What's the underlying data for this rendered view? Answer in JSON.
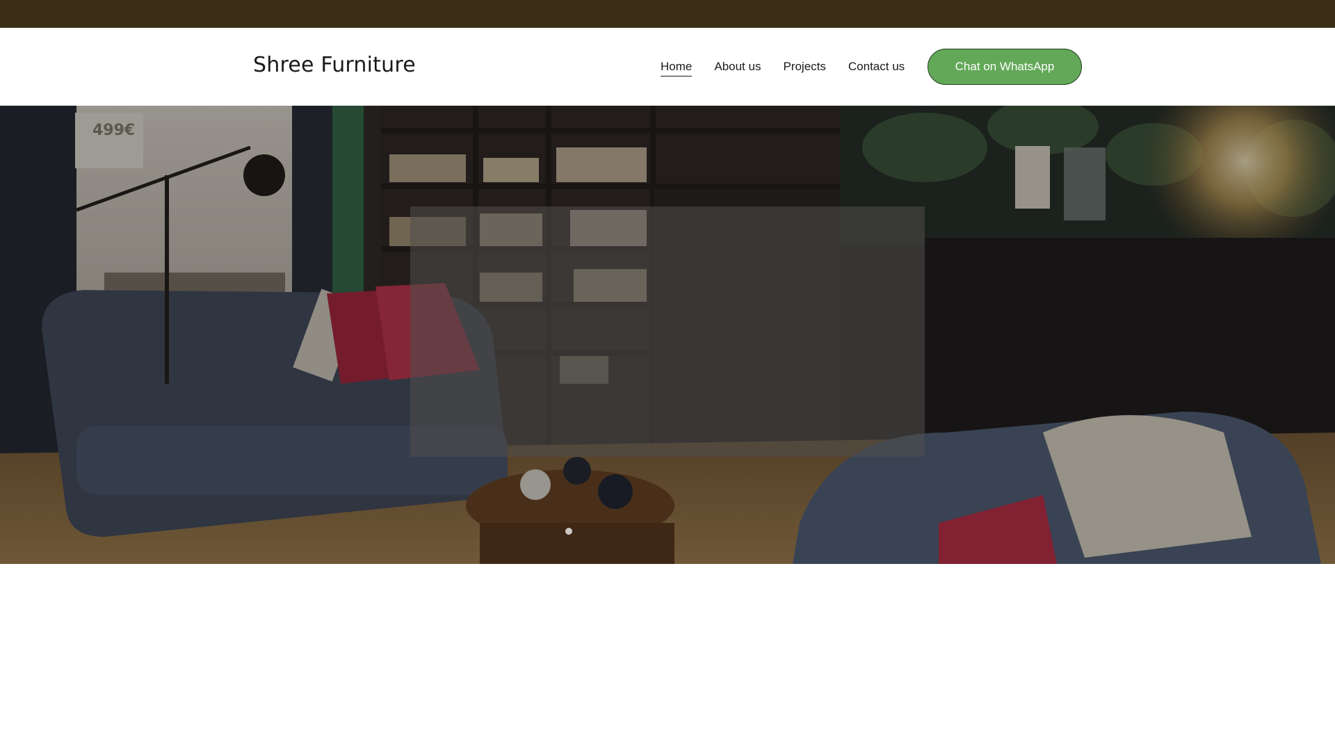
{
  "header": {
    "brand": "Shree Furniture",
    "nav": [
      {
        "label": "Home",
        "active": true
      },
      {
        "label": "About us",
        "active": false
      },
      {
        "label": "Projects",
        "active": false
      },
      {
        "label": "Contact us",
        "active": false
      }
    ],
    "cta_label": "Chat on WhatsApp"
  },
  "hero": {
    "price_tag": "499€"
  },
  "colors": {
    "announcement_bar": "#3a2e17",
    "cta_fill": "#62a858",
    "cta_border": "#1f3a1b"
  }
}
